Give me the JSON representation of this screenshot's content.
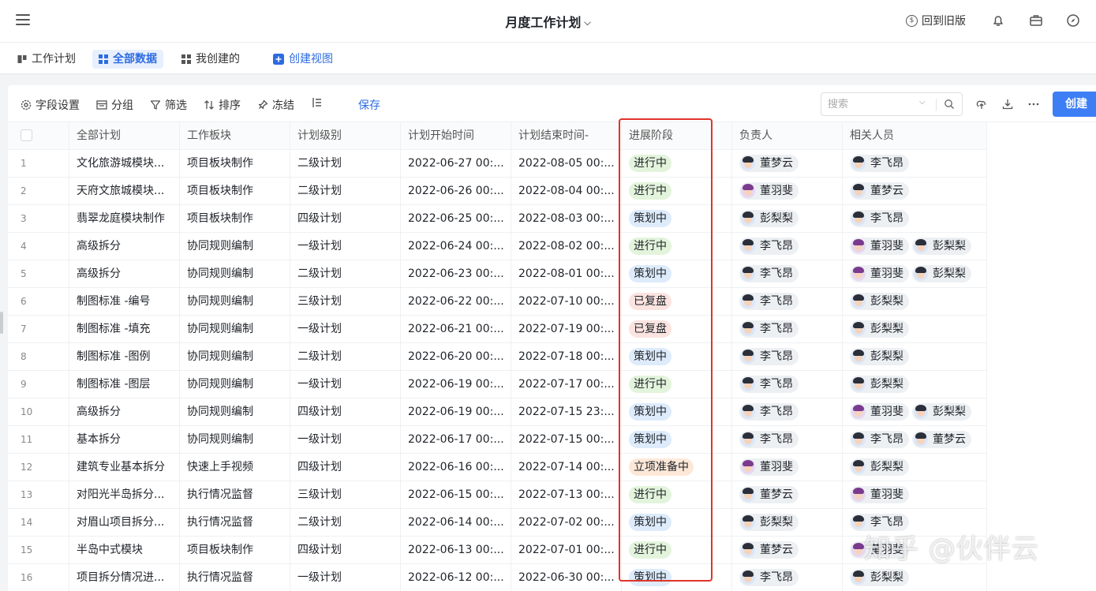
{
  "header": {
    "title": "月度工作计划",
    "back_to_old": "回到旧版"
  },
  "tabs": [
    {
      "label": "工作计划",
      "active": false
    },
    {
      "label": "全部数据",
      "active": true
    },
    {
      "label": "我创建的",
      "active": false
    }
  ],
  "create_view": "创建视图",
  "toolbar": {
    "field_settings": "字段设置",
    "group": "分组",
    "filter": "筛选",
    "sort": "排序",
    "freeze": "冻结",
    "save": "保存",
    "search_placeholder": "搜索",
    "create": "创建"
  },
  "columns": [
    "全部计划",
    "工作板块",
    "计划级别",
    "计划开始时间",
    "计划结束时间-",
    "进展阶段",
    "负责人",
    "相关人员"
  ],
  "colors": {
    "accent": "#3d7ef5",
    "highlight_border": "#e0342a",
    "stage": {
      "进行中": {
        "bg": "#e3f4dc",
        "fg": "#1f2329"
      },
      "策划中": {
        "bg": "#ddebfb",
        "fg": "#1f2329"
      },
      "已复盘": {
        "bg": "#fbe3e0",
        "fg": "#1f2329"
      },
      "立项准备中": {
        "bg": "#fde8d8",
        "fg": "#1f2329"
      }
    },
    "people": {
      "董梦云": "#2a2f3a",
      "董羽斐": "#7a3b8f",
      "彭梨梨": "#2a2f3a",
      "李飞昂": "#2a2f3a"
    }
  },
  "rows": [
    {
      "no": "1",
      "plan": "文化旅游城模块...",
      "board": "项目板块制作",
      "level": "二级计划",
      "start": "2022-06-27 00:...",
      "end": "2022-08-05 00:...",
      "stage": "进行中",
      "owner": [
        "董梦云"
      ],
      "related": [
        "李飞昂"
      ]
    },
    {
      "no": "2",
      "plan": "天府文旅城模块...",
      "board": "项目板块制作",
      "level": "二级计划",
      "start": "2022-06-26 00:...",
      "end": "2022-08-04 00:...",
      "stage": "进行中",
      "owner": [
        "董羽斐"
      ],
      "related": [
        "董梦云"
      ]
    },
    {
      "no": "3",
      "plan": "翡翠龙庭模块制作",
      "board": "项目板块制作",
      "level": "四级计划",
      "start": "2022-06-25 00:...",
      "end": "2022-08-03 00:...",
      "stage": "策划中",
      "owner": [
        "彭梨梨"
      ],
      "related": [
        "李飞昂"
      ]
    },
    {
      "no": "4",
      "plan": "高级拆分",
      "board": "协同规则编制",
      "level": "一级计划",
      "start": "2022-06-24 00:...",
      "end": "2022-08-02 00:...",
      "stage": "进行中",
      "owner": [
        "李飞昂"
      ],
      "related": [
        "董羽斐",
        "彭梨梨"
      ]
    },
    {
      "no": "5",
      "plan": "高级拆分",
      "board": "协同规则编制",
      "level": "二级计划",
      "start": "2022-06-23 00:...",
      "end": "2022-08-01 00:...",
      "stage": "策划中",
      "owner": [
        "李飞昂"
      ],
      "related": [
        "董羽斐",
        "彭梨梨"
      ]
    },
    {
      "no": "6",
      "plan": "制图标准 -编号",
      "board": "协同规则编制",
      "level": "三级计划",
      "start": "2022-06-22 00:...",
      "end": "2022-07-10 00:...",
      "stage": "已复盘",
      "owner": [
        "李飞昂"
      ],
      "related": [
        "彭梨梨"
      ]
    },
    {
      "no": "7",
      "plan": "制图标准 -填充",
      "board": "协同规则编制",
      "level": "一级计划",
      "start": "2022-06-21 00:...",
      "end": "2022-07-19 00:...",
      "stage": "已复盘",
      "owner": [
        "李飞昂"
      ],
      "related": [
        "彭梨梨"
      ]
    },
    {
      "no": "8",
      "plan": "制图标准 -图例",
      "board": "协同规则编制",
      "level": "二级计划",
      "start": "2022-06-20 00:...",
      "end": "2022-07-18 00:...",
      "stage": "策划中",
      "owner": [
        "李飞昂"
      ],
      "related": [
        "彭梨梨"
      ]
    },
    {
      "no": "9",
      "plan": "制图标准 -图层",
      "board": "协同规则编制",
      "level": "一级计划",
      "start": "2022-06-19 00:...",
      "end": "2022-07-17 00:...",
      "stage": "进行中",
      "owner": [
        "李飞昂"
      ],
      "related": [
        "彭梨梨"
      ]
    },
    {
      "no": "10",
      "plan": "高级拆分",
      "board": "协同规则编制",
      "level": "四级计划",
      "start": "2022-06-19 00:...",
      "end": "2022-07-15 23:...",
      "stage": "策划中",
      "owner": [
        "李飞昂"
      ],
      "related": [
        "董羽斐",
        "彭梨梨"
      ]
    },
    {
      "no": "11",
      "plan": "基本拆分",
      "board": "协同规则编制",
      "level": "一级计划",
      "start": "2022-06-17 00:...",
      "end": "2022-07-15 00:...",
      "stage": "策划中",
      "owner": [
        "李飞昂"
      ],
      "related": [
        "李飞昂",
        "董梦云"
      ]
    },
    {
      "no": "12",
      "plan": "建筑专业基本拆分",
      "board": "快速上手视频",
      "level": "四级计划",
      "start": "2022-06-16 00:...",
      "end": "2022-07-14 00:...",
      "stage": "立项准备中",
      "owner": [
        "董羽斐"
      ],
      "related": [
        "彭梨梨"
      ]
    },
    {
      "no": "13",
      "plan": "对阳光半岛拆分...",
      "board": "执行情况监督",
      "level": "三级计划",
      "start": "2022-06-15 00:...",
      "end": "2022-07-13 00:...",
      "stage": "进行中",
      "owner": [
        "董梦云"
      ],
      "related": [
        "董羽斐"
      ]
    },
    {
      "no": "14",
      "plan": "对眉山项目拆分...",
      "board": "执行情况监督",
      "level": "二级计划",
      "start": "2022-06-14 00:...",
      "end": "2022-07-02 00:...",
      "stage": "策划中",
      "owner": [
        "彭梨梨"
      ],
      "related": [
        "李飞昂"
      ]
    },
    {
      "no": "15",
      "plan": "半岛中式模块",
      "board": "项目板块制作",
      "level": "四级计划",
      "start": "2022-06-13 00:...",
      "end": "2022-07-01 00:...",
      "stage": "进行中",
      "owner": [
        "董梦云"
      ],
      "related": [
        "董羽斐"
      ]
    },
    {
      "no": "16",
      "plan": "项目拆分情况进...",
      "board": "执行情况监督",
      "level": "一级计划",
      "start": "2022-06-12 00:...",
      "end": "2022-06-30 00:...",
      "stage": "策划中",
      "owner": [
        "李飞昂"
      ],
      "related": [
        "彭梨梨"
      ]
    }
  ],
  "watermark": "知乎 @伙伴云"
}
